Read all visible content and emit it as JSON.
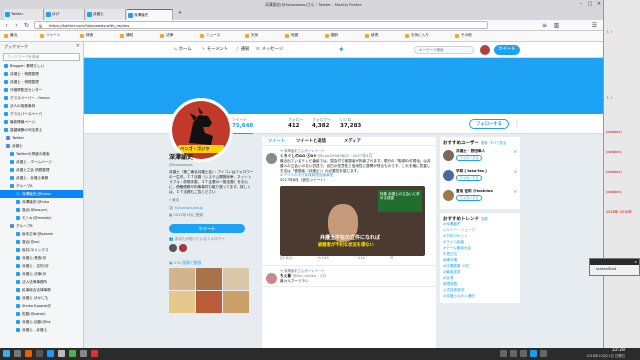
{
  "window": {
    "title": "深澤諭史(@fukazawas)さん｜Twitter - Mozilla Firefox"
  },
  "tabs": [
    {
      "label": "Twitter"
    },
    {
      "label": "ほげ"
    },
    {
      "label": "弁護士"
    },
    {
      "label": "深澤諭史"
    }
  ],
  "nav": {
    "url": "https://twitter.com/fukazawas/with_replies"
  },
  "bookmarks_bar": [
    {
      "label": "最近"
    },
    {
      "label": "ツイート"
    },
    {
      "label": "検索"
    },
    {
      "label": "通知"
    },
    {
      "label": "法律"
    },
    {
      "label": "ニュース"
    },
    {
      "label": "天気"
    },
    {
      "label": "地図"
    },
    {
      "label": "翻訳"
    },
    {
      "label": "辞書"
    },
    {
      "label": "お気に入り"
    },
    {
      "label": "その他"
    }
  ],
  "sidebar": {
    "title": "ブックマーク",
    "search_placeholder": "ブックマークを検索",
    "items": [
      {
        "label": "Blogger: 素晴らしい"
      },
      {
        "label": "弁護士・債務整理"
      },
      {
        "label": "弁護士・債務整理"
      },
      {
        "label": "冷蔵庫配送センター"
      },
      {
        "label": "グラスペーパー - fresno"
      },
      {
        "label": "法人の実務事例"
      },
      {
        "label": "グラスパースペーパ"
      },
      {
        "label": "最新情報ページ"
      },
      {
        "label": "高額報酬の司法書士"
      },
      {
        "label": "Twitter"
      },
      {
        "label": "弁護士"
      },
      {
        "label": "Twitterの再度の検索"
      },
      {
        "label": "弁護士 - ホームページ"
      },
      {
        "label": "弁護士之会 債務整理"
      },
      {
        "label": "弁護士 - 弁護士事務"
      },
      {
        "label": "グループA"
      },
      {
        "label": "深澤諭史(@fukaz"
      },
      {
        "label": "深澤諭史(@fuka"
      },
      {
        "label": "落合(@lawyer)"
      },
      {
        "label": "モトキ(@motoki)"
      },
      {
        "label": "グループB"
      },
      {
        "label": "坂本正幸(@sakam"
      },
      {
        "label": "落合(@sa)"
      },
      {
        "label": "坂井(3)リンクス"
      },
      {
        "label": "弁護士-長島(@"
      },
      {
        "label": "弁護士 - 吉村(@"
      },
      {
        "label": "弁護士-法律(@"
      },
      {
        "label": "法人法律事務所"
      },
      {
        "label": "民事総合法律事務"
      },
      {
        "label": "弁護士 ほかにも"
      },
      {
        "label": "Shoko Egawa(@"
      },
      {
        "label": "佐藤(@satoh)"
      },
      {
        "label": "弁護士-加藤(@ka"
      },
      {
        "label": "弁護士 - 弁護士"
      }
    ],
    "selected_index": 16
  },
  "twitter_nav": {
    "home": "ホーム",
    "moments": "モーメント",
    "notifications": "通知",
    "messages": "メッセージ",
    "search_placeholder": "キーワード検索",
    "tweet_button": "ツイート"
  },
  "profile": {
    "name": "深澤諭史",
    "handle": "@fukazawas",
    "bio": "弁護士（第二東京弁護士会）・アイコンはフォロワーの一生作。ＩＴ法務（システム開発紛争、ネットトラブル・詐欺手数、ＩＴ企業の一般法務）を中心に、債権債務や刑事事件も取り扱ってます。詳しくは、ＩＴ法務もご覧ください",
    "location": "東京",
    "link": "fukazawa-law.jp",
    "joined": "2012年3月に登録",
    "tweet_button": "ツイート",
    "followers_you_know": "あなたが知っているフォロワー",
    "media_label": "232 画像と動画",
    "stats": [
      {
        "label": "ツイート",
        "value": "75,848"
      },
      {
        "label": "フォロー",
        "value": "412"
      },
      {
        "label": "フォロワー",
        "value": "4,382"
      },
      {
        "label": "いいね",
        "value": "37,283"
      }
    ],
    "follow_button": "フォローする",
    "avatar_caption": "ベンゴ・ゴジラ"
  },
  "timeline": {
    "tabs": [
      "ツイート",
      "ツイートと返信",
      "メディア"
    ],
    "tweets": [
      {
        "context": "深澤諭史さんがリツイート",
        "author": "くろぐしのGO ⓐ0⑨",
        "meta": "@kuro19900802 · 2017年4月",
        "text": "最近出ているテレビ番組では、国会付で被疑者が拘束されます。現行の「取調の可視化」は弁護人の立会いのない供述で、自白の任意性と信用性に疑問が残るものです。これを機に見直し方法は「被疑者（弁護士）」の必要性を感じます。",
        "link": "#アベマの手元英雄新国会議事堂",
        "date": "2017年8月（過去ツイート）",
        "media_caption1": "弁護士不在の立件になれば",
        "media_caption2": "被疑者が不利な状況を得ない",
        "media_sign": "特集 弁護士の立会いに求める捜査",
        "actions": [
          "812",
          "143",
          "212",
          "✉"
        ]
      },
      {
        "context": "深澤諭史さんがリツイート",
        "author": "ちぇ新",
        "meta": "@the_midku · 1分",
        "text": "最カルブーミラン",
        "link": "",
        "date": "",
        "actions": [
          "",
          "",
          "",
          ""
        ]
      }
    ]
  },
  "who_to_follow": {
    "title": "おすすめユーザー",
    "refresh": "更新",
    "view_all": "すべて見る",
    "users": [
      {
        "name": "井護士 - 野田隼人",
        "button": "フォローする"
      },
      {
        "name": "平和 [ taka-fas ]",
        "button": "フォローする"
      },
      {
        "name": "豊島 佐和 @toshima",
        "button": "フォローする"
      }
    ]
  },
  "trends": {
    "title": "おすすめトレンド",
    "change": "変更",
    "items": [
      {
        "tag": "#深澤諭史",
        "sub": ""
      },
      {
        "tag": "ジャジー・ニューリ",
        "sub": ""
      },
      {
        "tag": "#下町ロケット",
        "sub": ""
      },
      {
        "tag": "#マツコ会議",
        "sub": ""
      },
      {
        "tag": "#ゲーム最強大会",
        "sub": ""
      },
      {
        "tag": "中居正広",
        "sub": ""
      },
      {
        "tag": "画像年業",
        "sub": ""
      },
      {
        "tag": "#日曜劇場 小田",
        "sub": ""
      },
      {
        "tag": "#最強技見",
        "sub": ""
      },
      {
        "tag": "#台湾",
        "sub": ""
      },
      {
        "tag": "新規発表",
        "sub": ""
      },
      {
        "tag": "公式技術新学",
        "sub": ""
      },
      {
        "tag": "#弁護士の大人通信",
        "sub": ""
      }
    ]
  },
  "mini_window": {
    "title": "",
    "body": "screenShot"
  },
  "desktop_right": {
    "strips": [
      "ｌｉ",
      "ｌｉ",
      "(dolphin)",
      "(dolphin)",
      "(dolphin)",
      "(dolphin)",
      "2018年 2018年"
    ]
  },
  "taskbar": {
    "time": "22:28",
    "date": "2018年10月21日 日曜日"
  }
}
